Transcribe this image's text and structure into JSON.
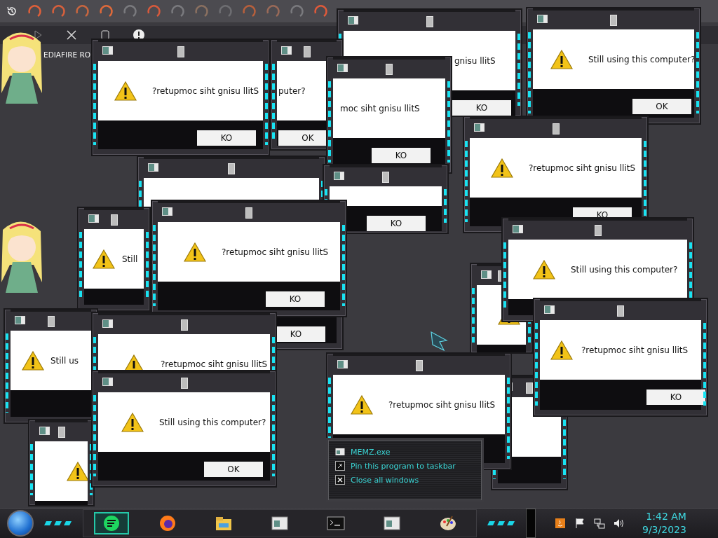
{
  "windows": [
    {
      "message": "gnisu llitS",
      "button": "KO"
    },
    {
      "message": "Still using this computer?",
      "button": "OK"
    },
    {
      "message": "?retupmoc siht gnisu llitS",
      "button": "KO"
    },
    {
      "message": "puter?",
      "button": "OK"
    },
    {
      "message": "moc siht gnisu llitS",
      "button": "KO"
    },
    {
      "button": "KO"
    },
    {
      "message": "?retupmoc siht gnisu llitS",
      "button": "KO"
    },
    {
      "message": "Still"
    },
    {
      "button": "KO"
    },
    {
      "message": "?retupmoc siht gnisu llitS",
      "button": "KO"
    },
    {
      "message": "Still using this computer?"
    },
    {
      "message": "?retupmoc siht gnisu llitS",
      "button": "KO"
    },
    {
      "message": "Still us"
    },
    {
      "message": "?retupmoc siht gnisu llitS"
    },
    {
      "message": "Still using this computer?",
      "button": "OK"
    },
    {
      "message": "?retupmoc siht gnisu llitS"
    }
  ],
  "desktop_icons": [
    {
      "label": "EDIAFIRE RO"
    }
  ],
  "jump_list": {
    "items": [
      {
        "label": "MEMZ.exe"
      },
      {
        "label": "Pin this program to taskbar"
      },
      {
        "label": "Close all windows"
      }
    ]
  },
  "clock": {
    "time": "1:42 AM",
    "date": "9/3/2023"
  }
}
